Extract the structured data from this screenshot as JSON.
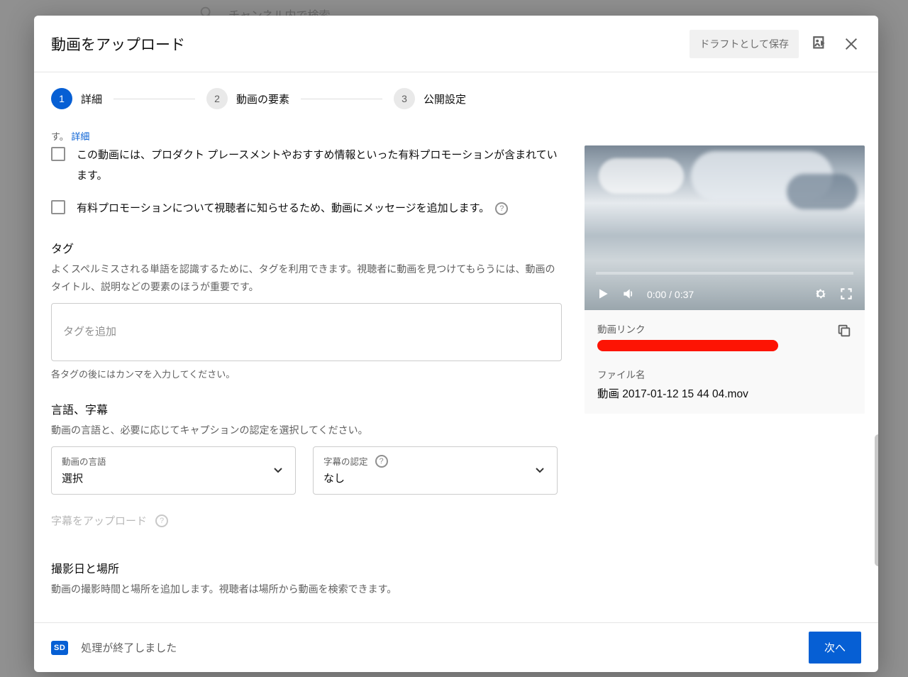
{
  "background": {
    "search_placeholder": "チャンネル内で検索"
  },
  "dialog": {
    "title": "動画をアップロード",
    "save_draft": "ドラフトとして保存"
  },
  "stepper": {
    "steps": [
      {
        "num": "1",
        "label": "詳細"
      },
      {
        "num": "2",
        "label": "動画の要素"
      },
      {
        "num": "3",
        "label": "公開設定"
      }
    ]
  },
  "truncated": {
    "prefix": "す。",
    "link": "詳細"
  },
  "checkboxes": {
    "paid_promo": "この動画には、プロダクト プレースメントやおすすめ情報といった有料プロモーションが含まれています。",
    "notify_viewers": "有料プロモーションについて視聴者に知らせるため、動画にメッセージを追加します。"
  },
  "tags": {
    "title": "タグ",
    "desc": "よくスペルミスされる単語を認識するために、タグを利用できます。視聴者に動画を見つけてもらうには、動画のタイトル、説明などの要素のほうが重要です。",
    "placeholder": "タグを追加",
    "hint": "各タグの後にはカンマを入力してください。"
  },
  "lang": {
    "title": "言語、字幕",
    "desc": "動画の言語と、必要に応じてキャプションの認定を選択してください。",
    "video_lang_label": "動画の言語",
    "video_lang_value": "選択",
    "cc_label": "字幕の認定",
    "cc_value": "なし",
    "upload_cc": "字幕をアップロード"
  },
  "shoot": {
    "title": "撮影日と場所",
    "desc": "動画の撮影時間と場所を追加します。視聴者は場所から動画を検索できます。"
  },
  "preview": {
    "time": "0:00 / 0:37",
    "link_label": "動画リンク",
    "file_label": "ファイル名",
    "file_name": "動画 2017-01-12 15 44 04.mov"
  },
  "footer": {
    "badge": "SD",
    "status": "処理が終了しました",
    "next": "次へ"
  }
}
